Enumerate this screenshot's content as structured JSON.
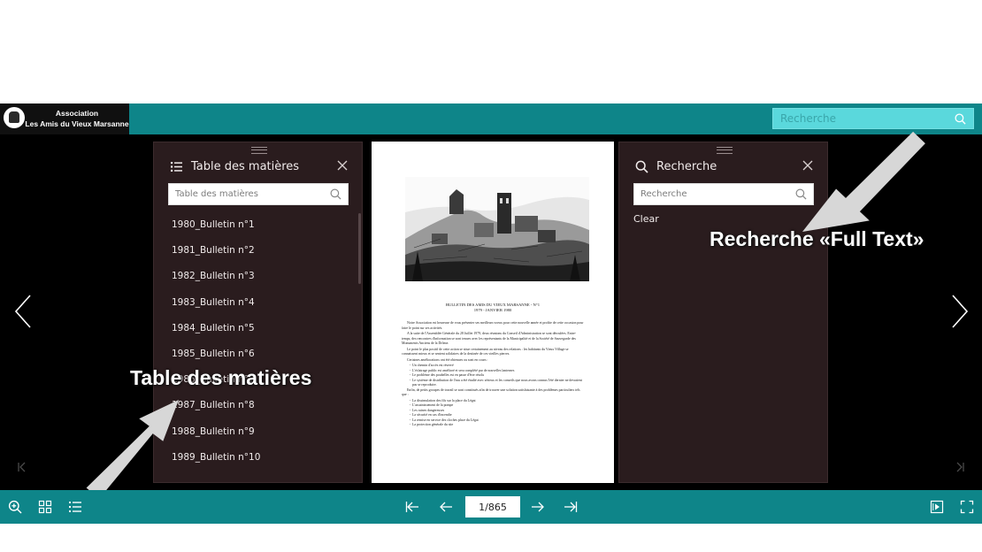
{
  "header": {
    "logo_line1": "Association",
    "logo_line2": "Les Amis du Vieux Marsanne",
    "search_placeholder": "Recherche"
  },
  "toc_panel": {
    "title": "Table des matières",
    "search_placeholder": "Table des matières",
    "items": [
      "1980_Bulletin n°1",
      "1981_Bulletin n°2",
      "1982_Bulletin n°3",
      "1983_Bulletin n°4",
      "1984_Bulletin n°5",
      "1985_Bulletin n°6",
      "1986_Bulletin n°7",
      "1987_Bulletin n°8",
      "1988_Bulletin n°9",
      "1989_Bulletin n°10"
    ]
  },
  "search_panel": {
    "title": "Recherche",
    "search_placeholder": "Recherche",
    "clear_label": "Clear"
  },
  "document": {
    "heading_line1": "BULLETIN DES AMIS DU VIEUX MARSANNE - N°1",
    "heading_line2": "1979 - JANVIER 1980",
    "para1": "Notre Association est heureuse de vous présenter ses meilleurs voeux pour cette nouvelle année et profite de cette occasion pour faire le point sur ses activités.",
    "para2": "A la suite de l'Assemblée Générale du 28 Juillet 1979, deux réunions du Conseil d'Administration se sont déroulées. Entre-temps, des rencontres d'information se sont tenues avec les représentants de la Municipalité et de la Société de Sauvegarde des Monuments Anciens de la Drôme.",
    "para3": "Le point le plus positif de cette action se situe certainement au niveau des relations : les habitants du Vieux Village se connaissent mieux et se sentent solidaires de la destinée de ces vieilles pierres.",
    "para4": "Certaines améliorations ont été obtenues ou sont en cours :",
    "list1": [
      "Un chemin d'accès est réservé",
      "L'éclairage public est amélioré et sera complété par de nouvelles lanternes",
      "Le problème des poubelles est en passe d'être résolu",
      "Le système de distribution de l'eau a été étudié avec sérieux et les conseils que nous avons connus l'été dernier ne devraient pas se reproduire."
    ],
    "para5": "Enfin, de petits groupes de travail se sont constitués afin de trouver une solution satisfaisante à des problèmes particuliers tels que :",
    "list2": [
      "La dissimulation des fils sur la place du Légat",
      "L'assainissement de la pompe",
      "Les ruines dangereuses",
      "La sécurité en cas d'incendie",
      "La remise en service des cloches place du Légat",
      "La protection générale du site"
    ]
  },
  "callouts": {
    "toc": "Table des matières",
    "search": "Recherche «Full Text»"
  },
  "toolbar": {
    "page_value": "1/865"
  },
  "colors": {
    "bar": "#0e8589",
    "panel": "#2a1c1e",
    "search_field": "#5ad8dc"
  }
}
